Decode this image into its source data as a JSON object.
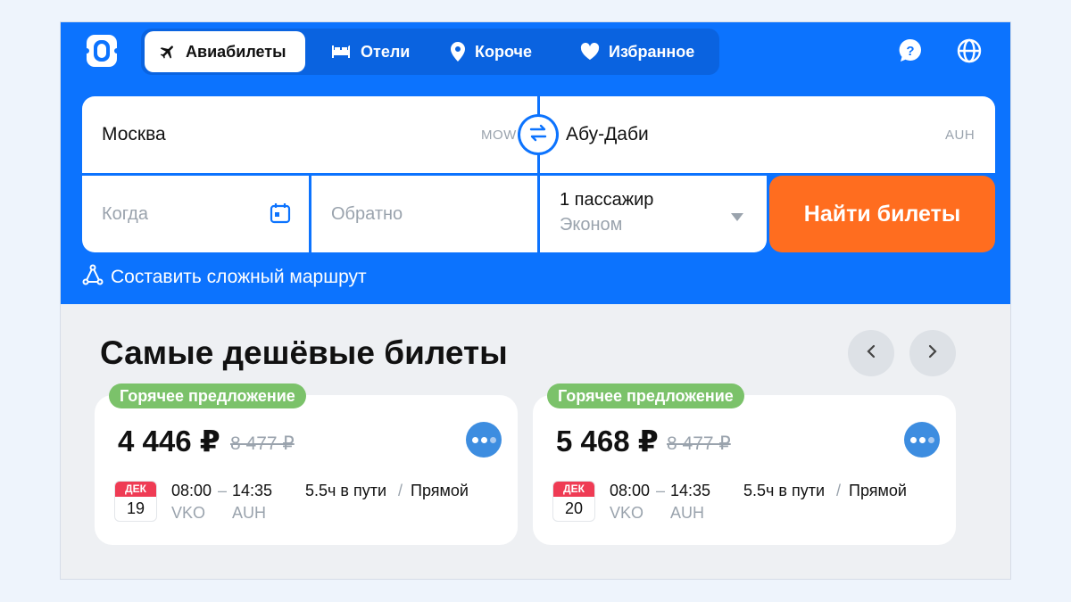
{
  "nav": {
    "tabs": [
      {
        "label": "Авиабилеты",
        "icon": "plane-icon",
        "active": true
      },
      {
        "label": "Отели",
        "icon": "bed-icon",
        "active": false
      },
      {
        "label": "Короче",
        "icon": "location-pin-icon",
        "active": false
      },
      {
        "label": "Избранное",
        "icon": "heart-icon",
        "active": false
      }
    ],
    "help_icon": "help-icon",
    "language_icon": "globe-icon"
  },
  "search": {
    "origin": {
      "city": "Москва",
      "code": "MOW"
    },
    "destination": {
      "city": "Абу-Даби",
      "code": "AUH"
    },
    "depart_placeholder": "Когда",
    "return_placeholder": "Обратно",
    "passengers": "1 пассажир",
    "cabin_class": "Эконом",
    "submit_label": "Найти билеты",
    "complex_route_label": "Составить сложный маршрут"
  },
  "deals": {
    "title": "Самые дешёвые билеты",
    "cards": [
      {
        "badge": "Горячее предложение",
        "price": "4 446 ₽",
        "old_price": "8 477 ₽",
        "month": "ДЕК",
        "day": "19",
        "depart_time": "08:00",
        "time_sep": "–",
        "arrive_time": "14:35",
        "from_airport": "VKO",
        "to_airport": "AUH",
        "duration": "5.5ч в пути",
        "sep": "/",
        "stops": "Прямой"
      },
      {
        "badge": "Горячее предложение",
        "price": "5 468 ₽",
        "old_price": "8 477 ₽",
        "month": "ДЕК",
        "day": "20",
        "depart_time": "08:00",
        "time_sep": "–",
        "arrive_time": "14:35",
        "from_airport": "VKO",
        "to_airport": "AUH",
        "duration": "5.5ч в пути",
        "sep": "/",
        "stops": "Прямой"
      }
    ]
  },
  "colors": {
    "brand_blue": "#0c73fe",
    "accent_orange": "#ff6d1f",
    "hot_green": "#7bc26a",
    "calendar_red": "#ef3b54"
  }
}
